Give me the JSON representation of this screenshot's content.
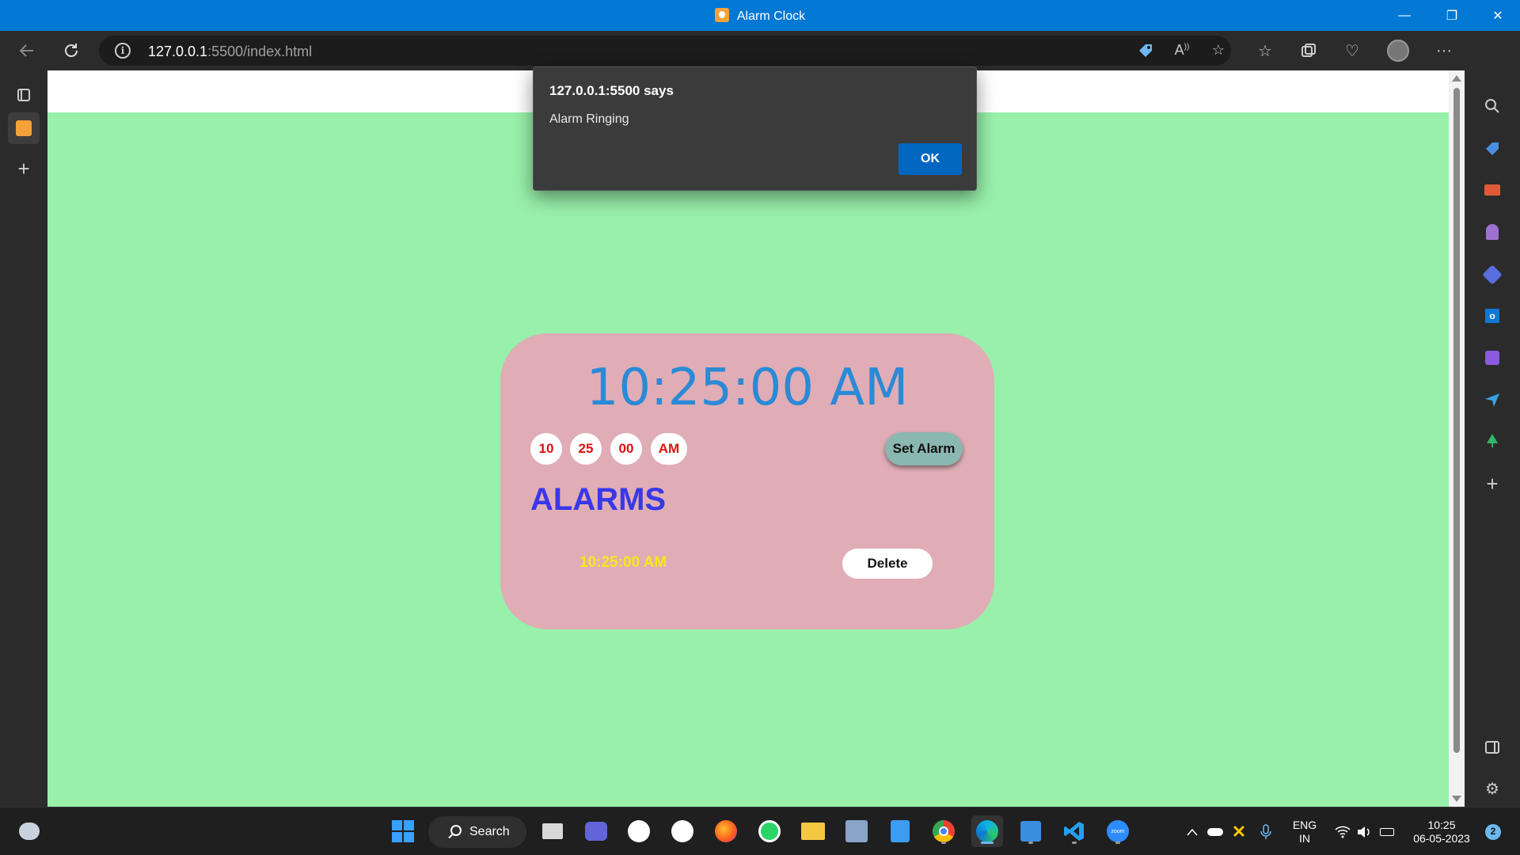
{
  "window": {
    "title": "Alarm Clock",
    "minimize": "—",
    "restore": "❐",
    "close": "✕"
  },
  "addressbar": {
    "url_host": "127.0.0.1",
    "url_rest": ":5500/index.html"
  },
  "page": {
    "clock": "10:25:00 AM",
    "inputs": {
      "hour": "10",
      "minute": "25",
      "second": "00",
      "ampm": "AM"
    },
    "set_alarm_label": "Set Alarm",
    "alarms_heading": "ALARMS",
    "alarms": [
      {
        "time": "10:25:00 AM",
        "delete_label": "Delete"
      }
    ],
    "colors": {
      "background": "#98f0aa",
      "card": "#e0adb6",
      "clock_text": "#2a8ad6",
      "heading": "#3838e8",
      "alarm_time": "#f5ea18"
    }
  },
  "dialog": {
    "title": "127.0.0.1:5500 says",
    "message": "Alarm Ringing",
    "ok_label": "OK"
  },
  "taskbar": {
    "search_label": "Search",
    "language_top": "ENG",
    "language_bottom": "IN",
    "time": "10:25",
    "date": "06-05-2023",
    "notification_count": "2"
  }
}
